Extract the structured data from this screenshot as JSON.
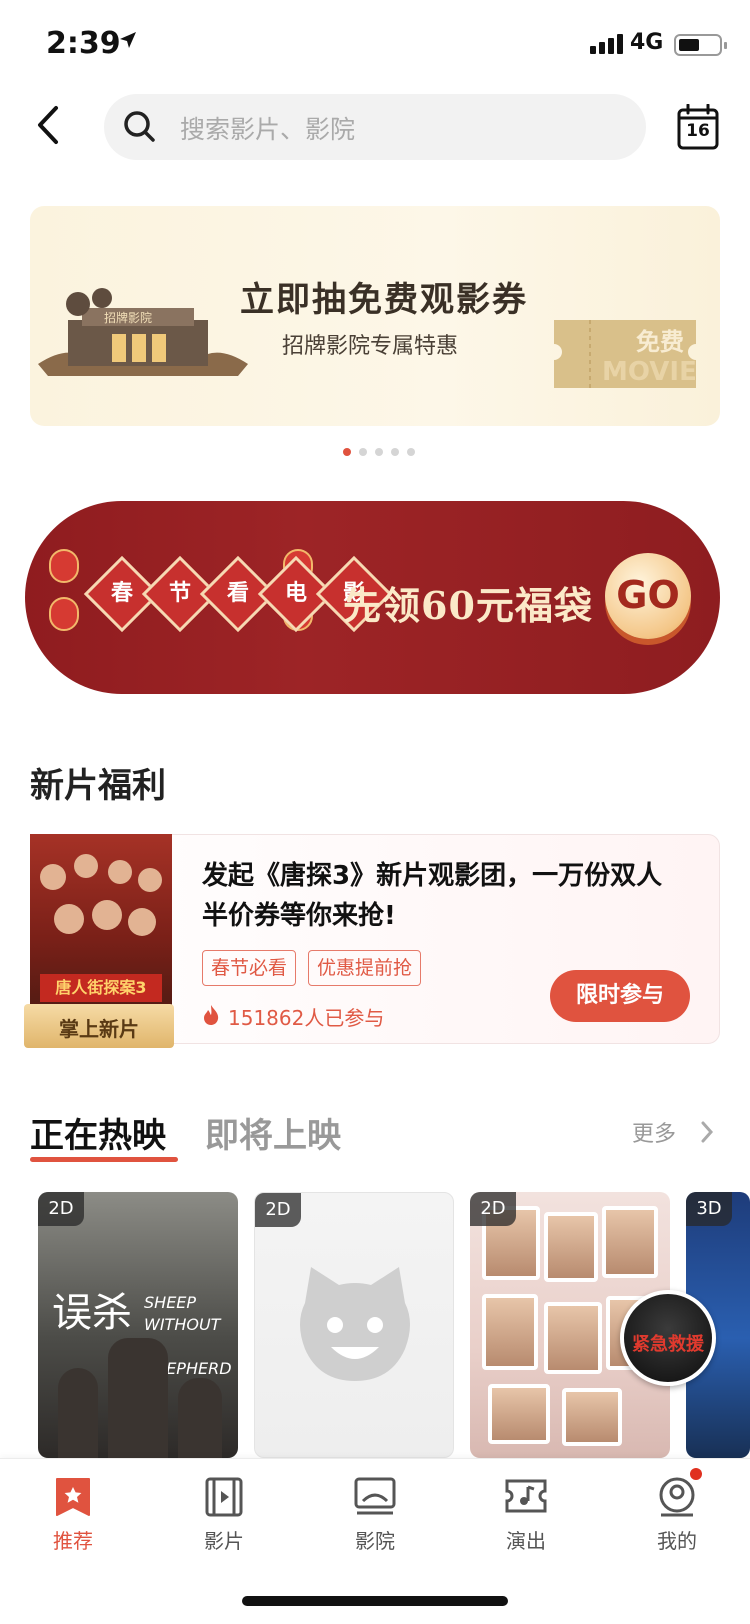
{
  "status_bar": {
    "time": "2:39",
    "network": "4G"
  },
  "search": {
    "placeholder": "搜索影片、影院"
  },
  "calendar": {
    "day": "16"
  },
  "banner": {
    "title": "立即抽免费观影券",
    "subtitle": "招牌影院专属特惠",
    "dots_total": 5,
    "dots_active": 1
  },
  "promo": {
    "diamonds": [
      "春",
      "节",
      "看",
      "电",
      "影"
    ],
    "text": "先领60元福袋",
    "go": "GO"
  },
  "section_title": "新片福利",
  "new_film": {
    "ribbon": "掌上新片",
    "title": "发起《唐探3》新片观影团，一万份双人半价券等你来抢!",
    "tags": [
      "春节必看",
      "优惠提前抢"
    ],
    "participants": "151862人已参与",
    "join_button": "限时参与"
  },
  "tabs": {
    "active": "正在热映",
    "inactive": "即将上映",
    "more": "更多"
  },
  "movies": [
    {
      "format": "2D",
      "title": "误杀",
      "title_en": "SHEEP WITHOUT A SHEPHERD"
    },
    {
      "format": "2D"
    },
    {
      "format": "2D"
    },
    {
      "format": "3D"
    }
  ],
  "bottom_nav": [
    {
      "label": "推荐",
      "icon": "star-bookmark-icon",
      "active": true
    },
    {
      "label": "影片",
      "icon": "film-icon",
      "active": false
    },
    {
      "label": "影院",
      "icon": "cinema-icon",
      "active": false
    },
    {
      "label": "演出",
      "icon": "music-ticket-icon",
      "active": false
    },
    {
      "label": "我的",
      "icon": "profile-icon",
      "active": false
    }
  ],
  "colors": {
    "accent": "#e0533f",
    "promo_red": "#8f1c1f",
    "banner_bg": "#fbf3de"
  }
}
